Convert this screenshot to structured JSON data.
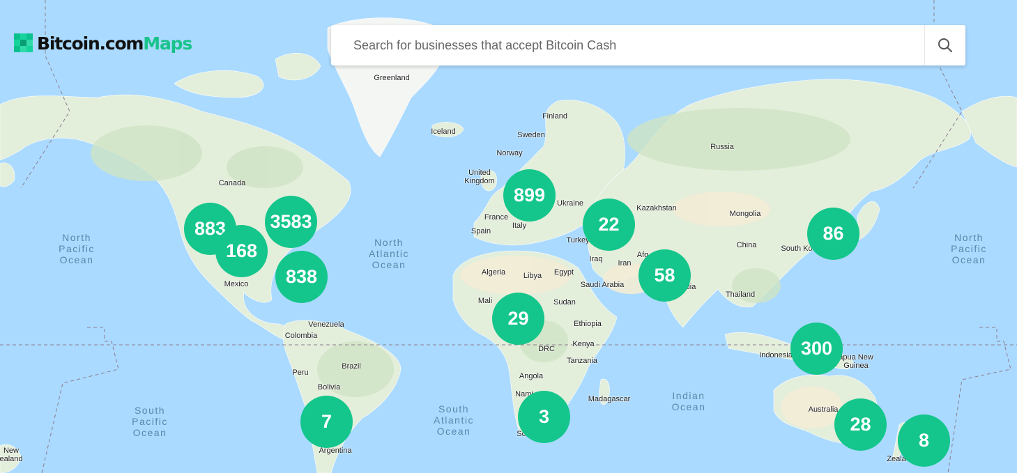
{
  "logo": {
    "part1": "Bitcoin.com",
    "part2": "Maps"
  },
  "search": {
    "placeholder": "Search for businesses that accept Bitcoin Cash"
  },
  "colors": {
    "marker": "#14c68b",
    "accent": "#19c38a",
    "water": "#aadaff",
    "land": "#e4eedb"
  },
  "clusters": [
    {
      "count": "883"
    },
    {
      "count": "168"
    },
    {
      "count": "3583"
    },
    {
      "count": "838"
    },
    {
      "count": "899"
    },
    {
      "count": "22"
    },
    {
      "count": "86"
    },
    {
      "count": "58"
    },
    {
      "count": "29"
    },
    {
      "count": "300"
    },
    {
      "count": "7"
    },
    {
      "count": "3"
    },
    {
      "count": "28"
    },
    {
      "count": "8"
    }
  ],
  "places": {
    "greenland": "Greenland",
    "iceland": "Iceland",
    "finland": "Finland",
    "sweden": "Sweden",
    "norway": "Norway",
    "russia": "Russia",
    "uk": "United\nKingdom",
    "canada": "Canada",
    "ukraine": "Ukraine",
    "kazakhstan": "Kazakhstan",
    "france": "France",
    "italy": "Italy",
    "spain": "Spain",
    "mongolia": "Mongolia",
    "turkey": "Turkey",
    "china": "China",
    "south_korea": "South Ko",
    "iraq": "Iraq",
    "iran": "Iran",
    "afghanistan": "Afg",
    "mexico": "Mexico",
    "algeria": "Algeria",
    "libya": "Libya",
    "egypt": "Egypt",
    "saudi_arabia": "Saudi Arabia",
    "india": "dia",
    "thailand": "Thailand",
    "mali": "Mali",
    "sudan": "Sudan",
    "ethiopia": "Ethiopia",
    "venezuela": "Venezuela",
    "colombia": "Colombia",
    "drc": "DRC",
    "kenya": "Kenya",
    "indonesia": "Indonesia",
    "png": "apua New\nGuinea",
    "brazil": "Brazil",
    "tanzania": "Tanzania",
    "peru": "Peru",
    "angola": "Angola",
    "bolivia": "Bolivia",
    "madagascar": "Madagascar",
    "namibia": "Nami",
    "australia": "Australia",
    "south_africa": "So",
    "argentina": "Argentina",
    "new_zealand_left": "New\nealand",
    "new_zealand_right": "Zeala"
  },
  "oceans": {
    "north_pacific_left": "North\nPacific\nOcean",
    "north_pacific_right": "North\nPacific\nOcean",
    "north_atlantic": "North\nAtlantic\nOcean",
    "south_pacific": "South\nPacific\nOcean",
    "south_atlantic": "South\nAtlantic\nOcean",
    "indian": "Indian\nOcean"
  }
}
